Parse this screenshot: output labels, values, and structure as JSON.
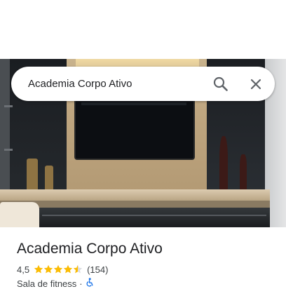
{
  "search": {
    "query": "Academia Corpo Ativo"
  },
  "icons": {
    "search": "search-icon",
    "close": "close-icon",
    "accessibility": "wheelchair-accessible-icon"
  },
  "place": {
    "name": "Academia Corpo Ativo",
    "rating": "4,5",
    "rating_numeric": 4.5,
    "max_stars": 5,
    "review_count": "(154)",
    "category": "Sala de fitness",
    "separator": "·"
  },
  "colors": {
    "star": "#fbbc04",
    "star_empty": "#dadce0",
    "accessibility_icon": "#1a73e8",
    "text_primary": "#202124",
    "text_secondary": "#3c4043"
  }
}
